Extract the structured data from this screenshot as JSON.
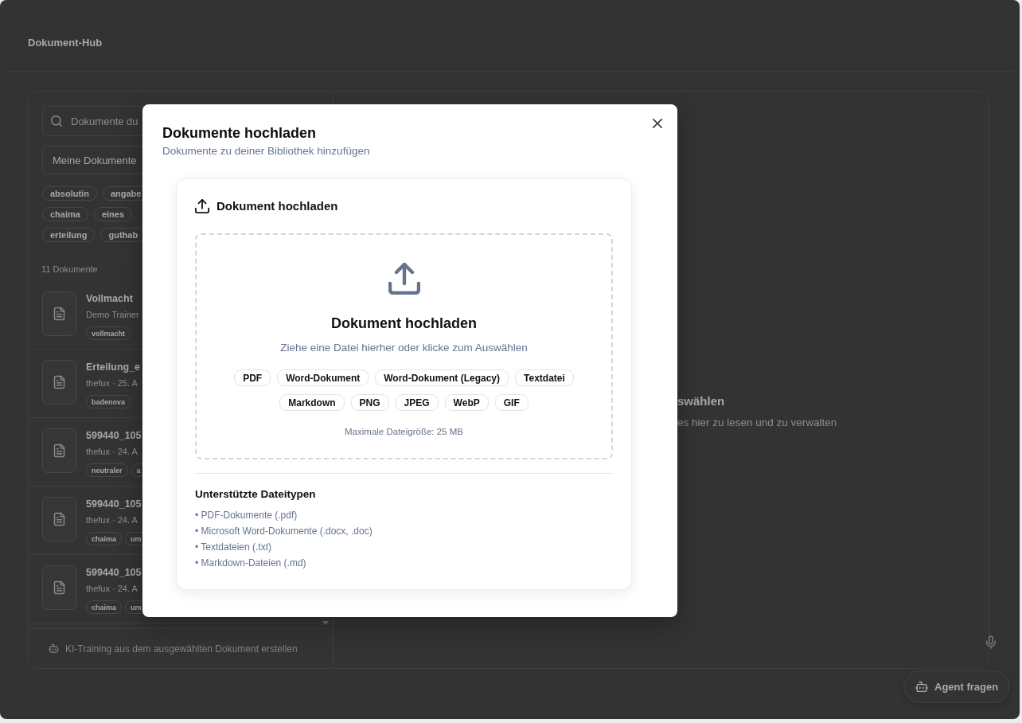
{
  "header": {
    "title": "Dokument-Hub"
  },
  "sidebar": {
    "search": {
      "placeholder": "Dokumente du"
    },
    "filter": {
      "value": "Meine Dokumente"
    },
    "tag_rows": [
      [
        "absolutin",
        "angabe"
      ],
      [
        "chaima",
        "eines"
      ],
      [
        "erteilung",
        "guthab"
      ]
    ],
    "count": "11 Dokumente",
    "documents": [
      {
        "title": "Vollmacht",
        "meta": "Demo Trainer",
        "tags": [
          "vollmacht"
        ]
      },
      {
        "title": "Erteilung_e",
        "meta": "thefux · 25. A",
        "tags": [
          "badenova"
        ]
      },
      {
        "title": "599440_105",
        "meta": "thefux · 24. A",
        "tags": [
          "neutraler",
          "a"
        ]
      },
      {
        "title": "599440_105",
        "meta": "thefux · 24. A",
        "tags": [
          "chaima",
          "um"
        ]
      },
      {
        "title": "599440_105",
        "meta": "thefux · 24. A",
        "tags": [
          "chaima",
          "um"
        ]
      }
    ],
    "training_button": {
      "label": "KI-Training aus dem ausgewählten Dokument erstellen",
      "disabled": true
    }
  },
  "viewer": {
    "title": "swählen",
    "text": "es hier zu lesen und zu verwalten"
  },
  "agent_button": {
    "label": "Agent fragen"
  },
  "dialog": {
    "title": "Dokumente hochladen",
    "subtitle": "Dokumente zu deiner Bibliothek hinzufügen",
    "card_title": "Dokument hochladen",
    "dropzone": {
      "title": "Dokument hochladen",
      "hint": "Ziehe eine Datei hierher oder klicke zum Auswählen",
      "format_rows": [
        [
          "PDF",
          "Word-Dokument",
          "Word-Dokument (Legacy)",
          "Textdatei"
        ],
        [
          "Markdown",
          "PNG",
          "JPEG",
          "WebP",
          "GIF"
        ]
      ],
      "limit": "Maximale Dateigröße: 25 MB"
    },
    "supported": {
      "title": "Unterstützte Dateitypen",
      "items": [
        "• PDF-Dokumente (.pdf)",
        "• Microsoft Word-Dokumente (.docx, .doc)",
        "• Textdateien (.txt)",
        "• Markdown-Dateien (.md)"
      ]
    }
  }
}
